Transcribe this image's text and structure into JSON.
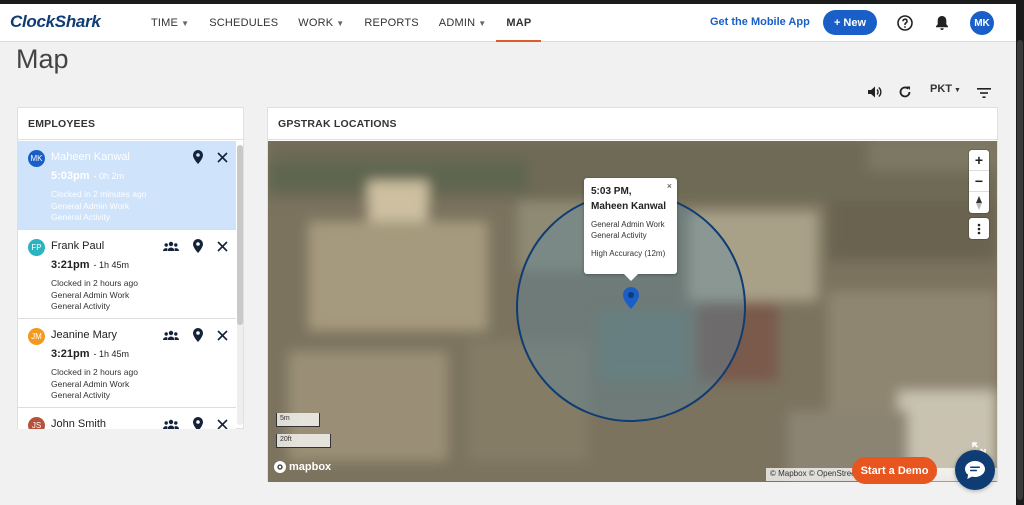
{
  "brand": {
    "logo": "ClockShark"
  },
  "nav": {
    "items": [
      {
        "label": "TIME",
        "caret": true
      },
      {
        "label": "SCHEDULES",
        "caret": false
      },
      {
        "label": "WORK",
        "caret": true
      },
      {
        "label": "REPORTS",
        "caret": false
      },
      {
        "label": "ADMIN",
        "caret": true
      },
      {
        "label": "MAP",
        "caret": false,
        "active": true
      }
    ],
    "mobile_link": "Get the Mobile App",
    "new_button": "+ New",
    "user_initials": "MK"
  },
  "page": {
    "title": "Map",
    "timezone": "PKT"
  },
  "employees": {
    "header": "EMPLOYEES",
    "list": [
      {
        "initials": "MK",
        "name": "Maheen Kanwal",
        "time": "5:03pm",
        "duration": "- 0h 2m",
        "clocked": "Clocked in 2 minutes ago",
        "job": "General Admin Work",
        "activity": "General Activity",
        "color": "#1a5fc7",
        "selected": true,
        "crew": false
      },
      {
        "initials": "FP",
        "name": "Frank Paul",
        "time": "3:21pm",
        "duration": "- 1h 45m",
        "clocked": "Clocked in 2 hours ago",
        "job": "General Admin Work",
        "activity": "General Activity",
        "color": "#2bb3c0",
        "selected": false,
        "crew": true
      },
      {
        "initials": "JM",
        "name": "Jeanine Mary",
        "time": "3:21pm",
        "duration": "- 1h 45m",
        "clocked": "Clocked in 2 hours ago",
        "job": "General Admin Work",
        "activity": "General Activity",
        "color": "#f29a1f",
        "selected": false,
        "crew": true
      },
      {
        "initials": "JS",
        "name": "John Smith",
        "time": "",
        "duration": "",
        "clocked": "",
        "job": "",
        "activity": "",
        "color": "#b5523b",
        "selected": false,
        "crew": true
      }
    ]
  },
  "map": {
    "header": "GPSTRAK LOCATIONS",
    "popup": {
      "time": "5:03 PM,",
      "name": "Maheen Kanwal",
      "job": "General Admin Work",
      "activity": "General Activity",
      "accuracy": "High Accuracy (12m)",
      "close": "×"
    },
    "scale_m": "5m",
    "scale_ft": "20ft",
    "logo": "mapbox",
    "attribution": "© Mapbox © OpenStreetMap  Improve this map",
    "accuracy_circle_color": "#0f3c73",
    "marker_color": "#1a5fc7"
  },
  "floating": {
    "demo_button": "Start a Demo"
  }
}
